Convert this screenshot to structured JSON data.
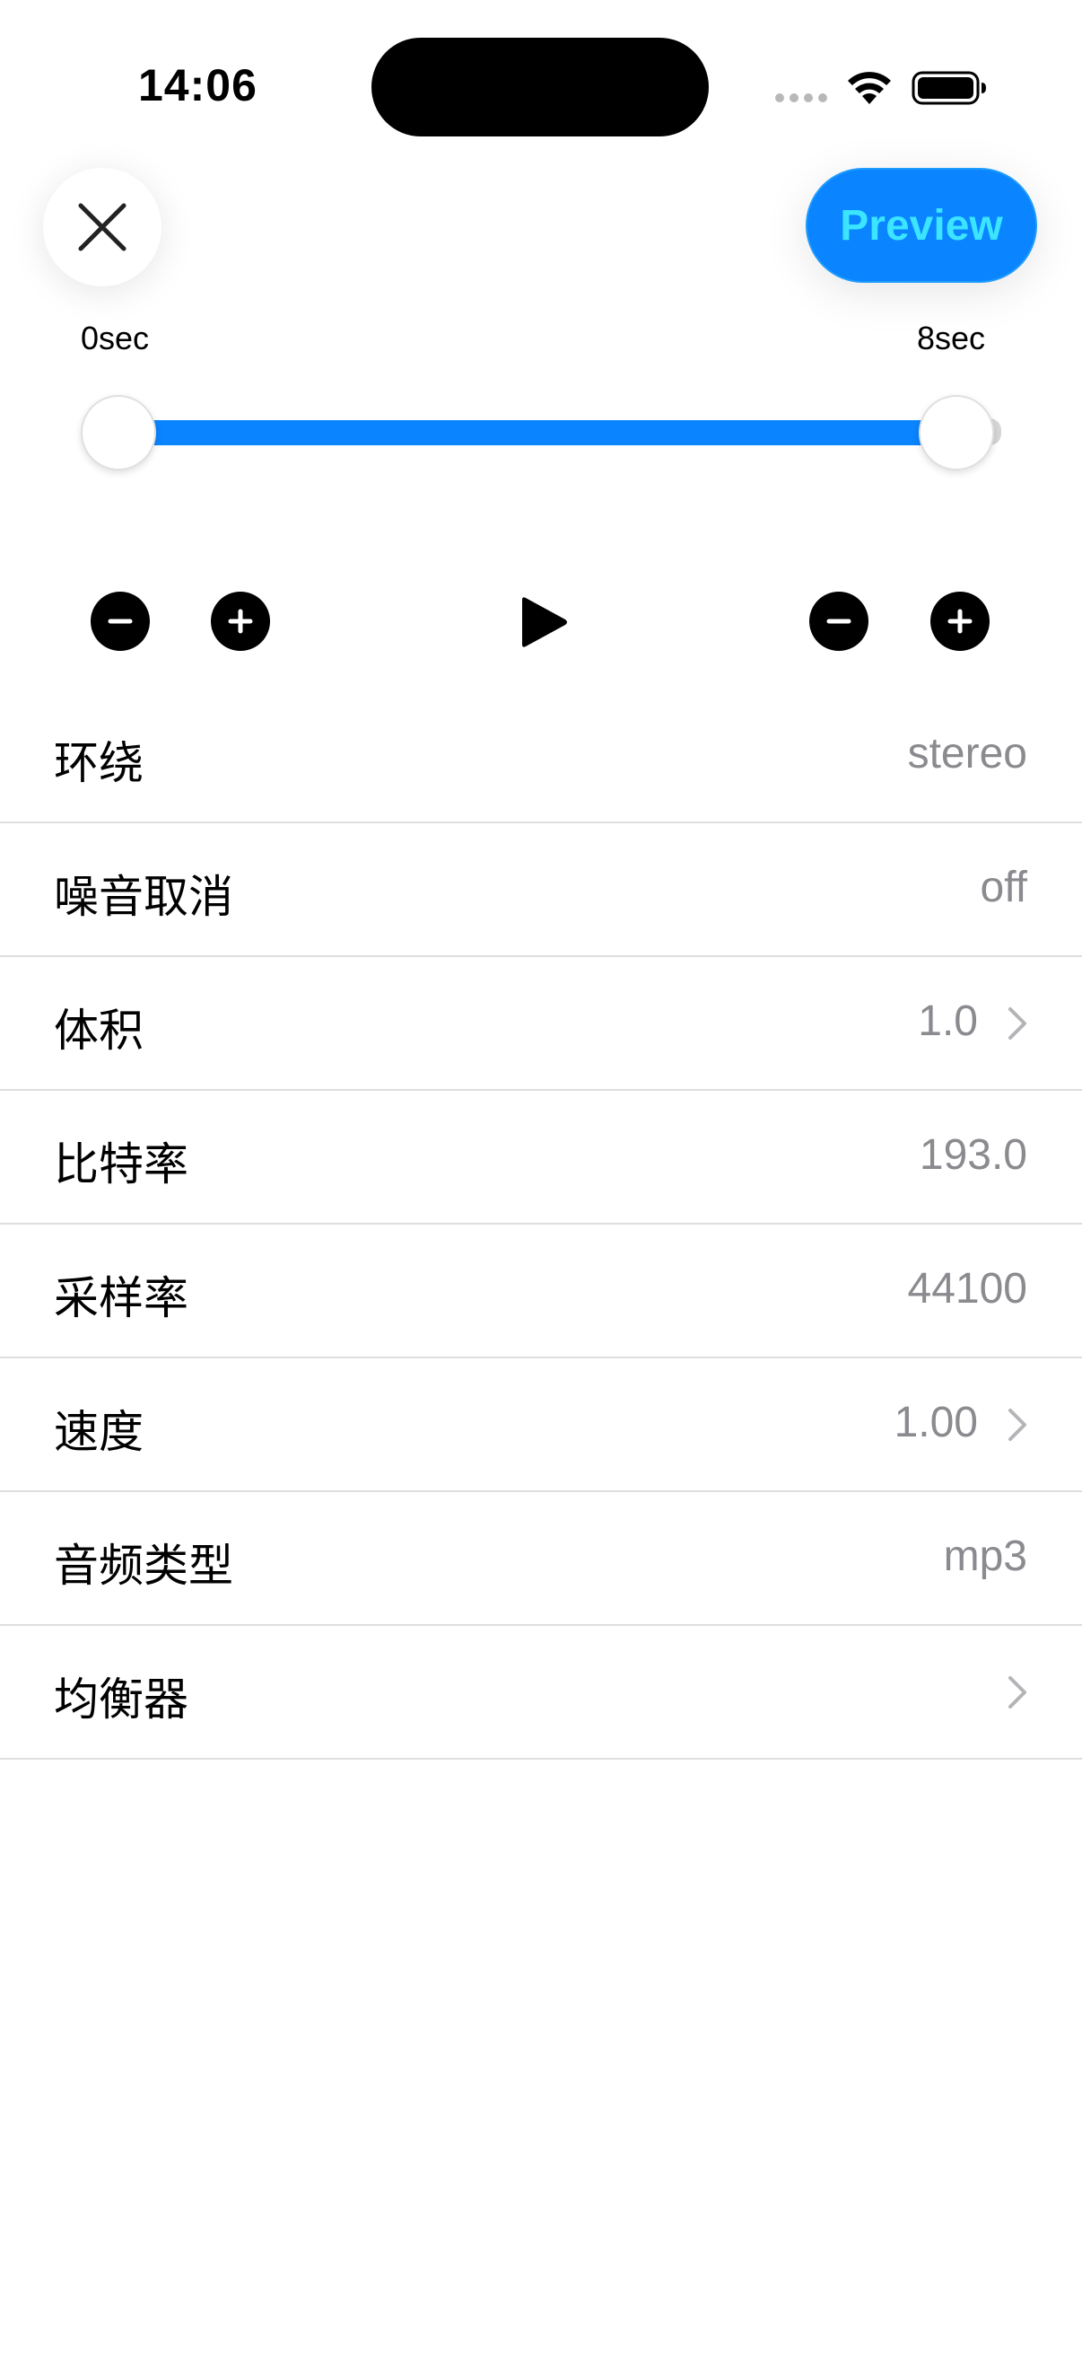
{
  "status_bar": {
    "time": "14:06"
  },
  "header": {
    "close_icon": "close-icon",
    "preview_label": "Preview",
    "accent_color": "#0a84ff",
    "preview_text_color": "#3be4ff"
  },
  "trim": {
    "start_label": "0sec",
    "end_label": "8sec"
  },
  "transport": {
    "icons": [
      "minus-icon",
      "plus-icon",
      "play-icon",
      "minus-icon",
      "plus-icon"
    ]
  },
  "settings": [
    {
      "label": "环绕",
      "value": "stereo",
      "chevron": false
    },
    {
      "label": "噪音取消",
      "value": "off",
      "chevron": false
    },
    {
      "label": "体积",
      "value": "1.0",
      "chevron": true
    },
    {
      "label": "比特率",
      "value": "193.0",
      "chevron": false
    },
    {
      "label": "采样率",
      "value": "44100",
      "chevron": false
    },
    {
      "label": "速度",
      "value": "1.00",
      "chevron": true
    },
    {
      "label": "音频类型",
      "value": "mp3",
      "chevron": false
    },
    {
      "label": "均衡器",
      "value": "",
      "chevron": true
    }
  ]
}
